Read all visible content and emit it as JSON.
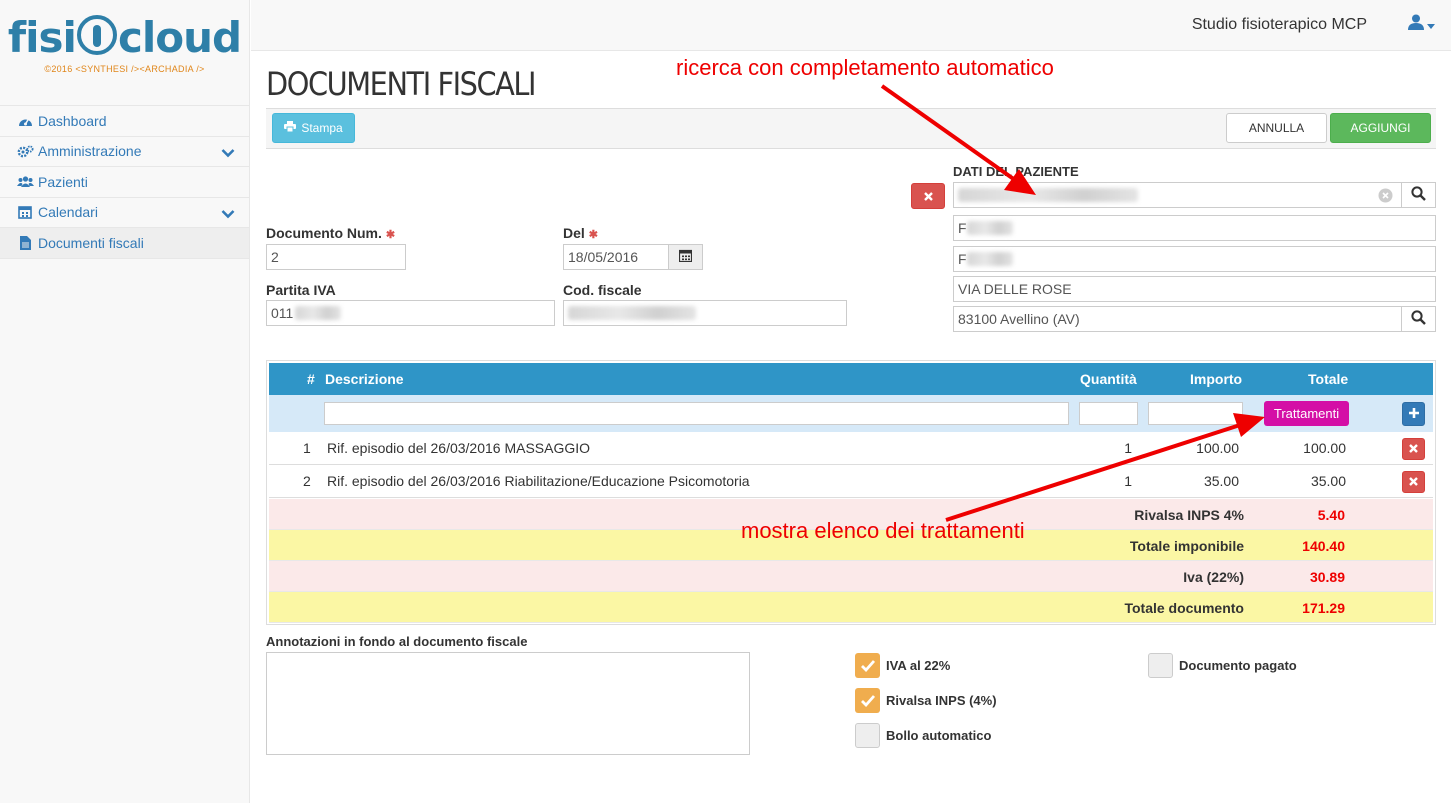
{
  "brand": {
    "logo_left": "fisi",
    "logo_right": "cloud",
    "logo_sub": "©2016 <SYNTHESI /><ARCHADIA />"
  },
  "sidebar": {
    "items": [
      {
        "label": "Dashboard",
        "icon": "dashboard-icon"
      },
      {
        "label": "Amministrazione",
        "icon": "gears-icon"
      },
      {
        "label": "Pazienti",
        "icon": "users-icon"
      },
      {
        "label": "Calendari",
        "icon": "calendar-icon"
      },
      {
        "label": "Documenti fiscali",
        "icon": "file-icon"
      }
    ]
  },
  "topbar": {
    "studio_name": "Studio fisioterapico MCP",
    "user_icon": "user-icon"
  },
  "page": {
    "title": "DOCUMENTI FISCALI"
  },
  "toolbar": {
    "print_label": "Stampa",
    "cancel_label": "ANNULLA",
    "add_label": "AGGIUNGI"
  },
  "form": {
    "doc_num_label": "Documento Num.",
    "doc_num_value": "2",
    "del_label": "Del",
    "del_value": "18/05/2016",
    "piva_label": "Partita IVA",
    "piva_value": "011",
    "codfisc_label": "Cod. fiscale",
    "patient_label": "DATI DEL PAZIENTE",
    "patient_line1": "F",
    "patient_line2": "F",
    "address": "VIA DELLE ROSE",
    "city": "83100 Avellino (AV)"
  },
  "table": {
    "headers": {
      "num": "#",
      "desc": "Descrizione",
      "qty": "Quantità",
      "price": "Importo",
      "total": "Totale"
    },
    "treatments_button": "Trattamenti",
    "rows": [
      {
        "num": "1",
        "desc": "Rif. episodio del 26/03/2016 MASSAGGIO",
        "qty": "1",
        "price": "100.00",
        "total": "100.00"
      },
      {
        "num": "2",
        "desc": "Rif. episodio del 26/03/2016 Riabilitazione/Educazione Psicomotoria",
        "qty": "1",
        "price": "35.00",
        "total": "35.00"
      }
    ],
    "summary": [
      {
        "label": "Rivalsa INPS 4%",
        "value": "5.40"
      },
      {
        "label": "Totale imponibile",
        "value": "140.40"
      },
      {
        "label": "Iva (22%)",
        "value": "30.89"
      },
      {
        "label": "Totale documento",
        "value": "171.29"
      }
    ]
  },
  "notes": {
    "label": "Annotazioni in fondo al documento fiscale"
  },
  "checks": {
    "iva": {
      "label": "IVA al 22%",
      "checked": true
    },
    "rivalsa": {
      "label": "Rivalsa INPS (4%)",
      "checked": true
    },
    "bollo": {
      "label": "Bollo automatico",
      "checked": false
    },
    "pagato": {
      "label": "Documento pagato",
      "checked": false
    }
  },
  "annotations": {
    "search": "ricerca con completamento automatico",
    "treatments": "mostra elenco dei trattamenti"
  },
  "colors": {
    "accent": "#337ab7",
    "header": "#2f95c7",
    "danger": "#d9534f",
    "success": "#5cb85c",
    "magenta": "#d40fa6",
    "annotation": "#e00000"
  }
}
